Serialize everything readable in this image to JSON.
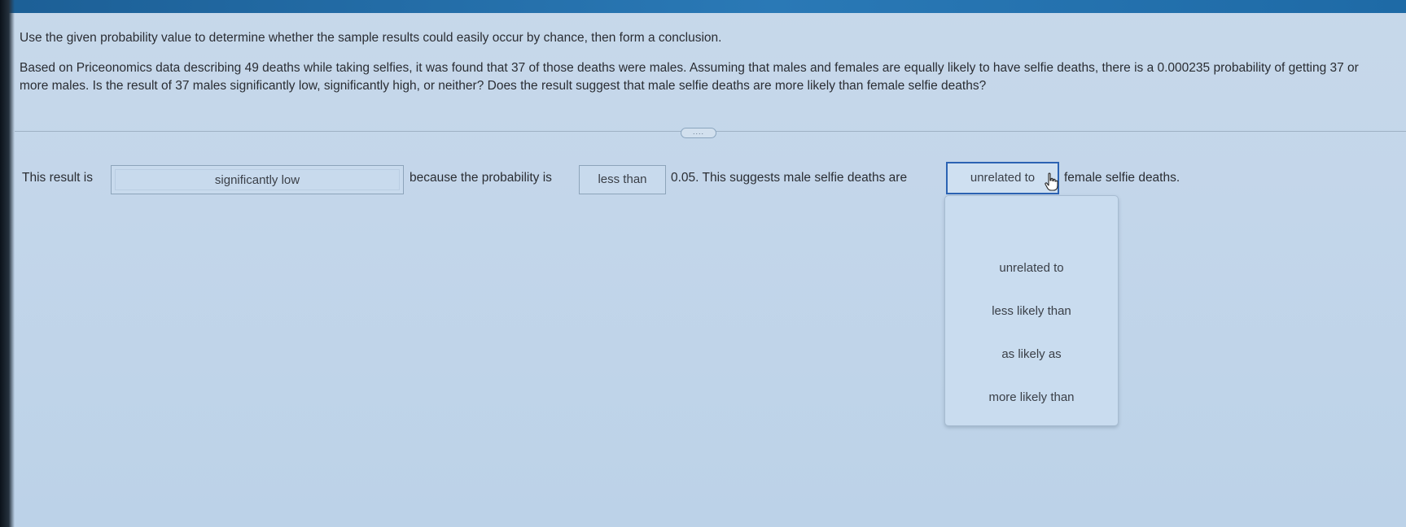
{
  "prompt": {
    "instruction": "Use the given probability value to determine whether the sample results could easily occur by chance, then form a conclusion.",
    "problem": "Based on Priceonomics data describing 49 deaths while taking selfies, it was found that 37 of those deaths were males. Assuming that males and females are equally likely to have selfie deaths, there is a 0.000235 probability of getting 37 or more males. Is the result of 37 males significantly low, significantly high, or neither? Does the result suggest that male selfie deaths are more likely than female selfie deaths?"
  },
  "toggle_more": "....",
  "answer": {
    "seg1": "This result is",
    "select1_value": "significantly low",
    "seg2": "because the probability is",
    "select2_value": "less than",
    "seg3": "0.05. This suggests male selfie deaths are",
    "select3_value": "unrelated to",
    "seg4": "female selfie deaths."
  },
  "dropdown": {
    "options": [
      "unrelated to",
      "less likely than",
      "as likely as",
      "more likely than"
    ]
  },
  "colors": {
    "focus_border": "#2c63b3",
    "header_bar": "#2a79b6"
  },
  "icons": {
    "cursor": "hand-pointer-icon"
  }
}
